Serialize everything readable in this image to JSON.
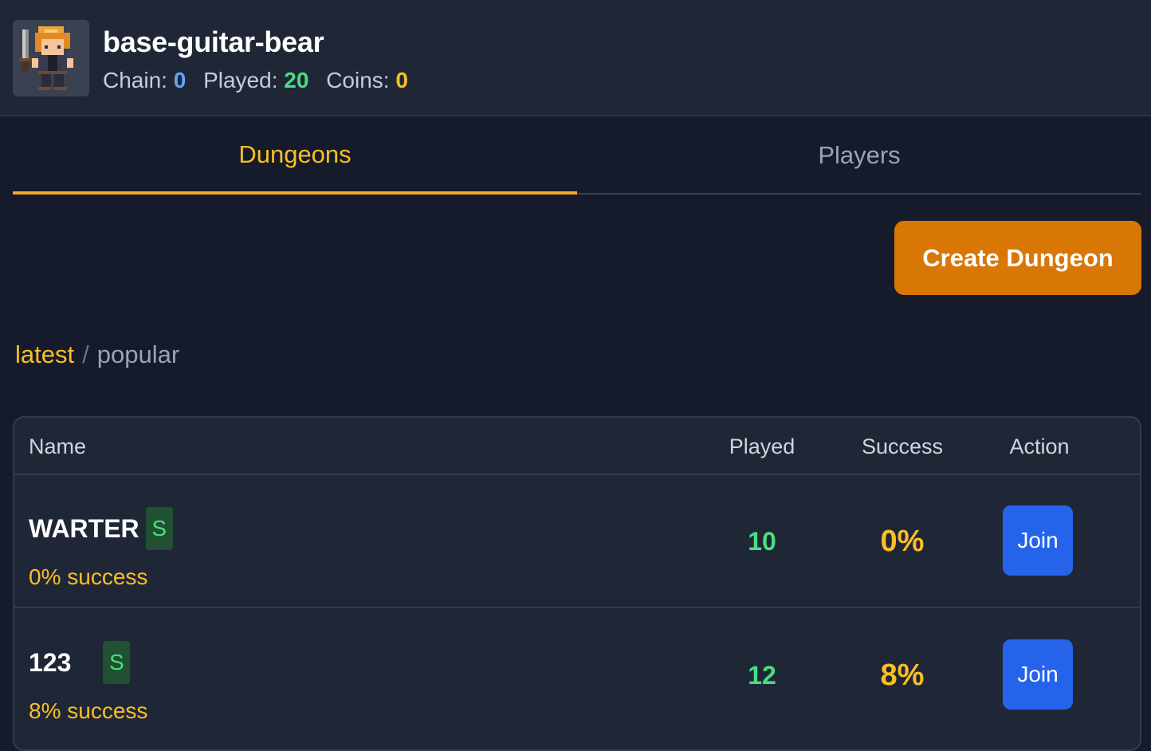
{
  "header": {
    "username": "base-guitar-bear",
    "chain_label": "Chain:",
    "chain_value": "0",
    "played_label": "Played:",
    "played_value": "20",
    "coins_label": "Coins:",
    "coins_value": "0",
    "avatar_icon": "pixel-knight-avatar"
  },
  "tabs": [
    {
      "label": "Dungeons",
      "active": true
    },
    {
      "label": "Players",
      "active": false
    }
  ],
  "create_button": "Create Dungeon",
  "sort": {
    "latest": "latest",
    "separator": "/",
    "popular": "popular"
  },
  "table": {
    "columns": [
      "Name",
      "Played",
      "Success",
      "Action"
    ],
    "rows": [
      {
        "name": "WARTER",
        "badge": "S",
        "subtitle": "0% success",
        "played": "10",
        "success": "0%",
        "action": "Join"
      },
      {
        "name": "123",
        "badge": "S",
        "subtitle": "8% success",
        "played": "12",
        "success": "8%",
        "action": "Join"
      }
    ]
  },
  "colors": {
    "accent": "#fbbf24",
    "create_button": "#d97706",
    "join_button": "#2563eb",
    "green": "#4ade80",
    "blue": "#60a5fa"
  }
}
